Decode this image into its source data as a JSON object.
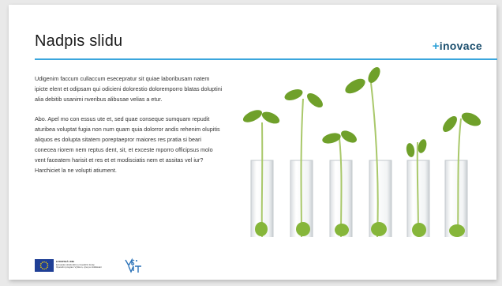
{
  "slide": {
    "title": "Nadpis slidu",
    "brand": {
      "plus": "+",
      "name": "inovace"
    },
    "paragraphs": [
      "Udigenim faccum cullaccum eseceprat­ur sit quiae laboribusam natem ipicte elent et odipsam qui odicieni dolorestio doloremporro blatas doluptini alia debitib usanimi nveribus alibusae velias a etur.",
      "Abo. Apel mo con essus ute et, sed quae conseque sumquam repudit aturibea voluptat fugia non num quam quia dolorror andis rehenim olupitis aliquos es dolupta sitatem poreptaepror maiores res pratia si beari conecea riorem nem reptus dent, sit, et exceste mporro officipsus molo vent faceatem harisit et res et et modisciatis nem et assitas vel iur? Harchiciet la ne volupti atiument."
    ]
  },
  "footer": {
    "eu_lines": [
      "EVROPSKÁ UNIE",
      "Evropské strukturální a investiční fondy",
      "Operační program Výzkum, vývoj a vzdělávání"
    ],
    "msmt_logo": "MŠMT",
    "icons": [
      "eu-flag-icon",
      "msmt-logo-icon"
    ]
  },
  "photo": {
    "subject": "seedlings-in-test-tubes"
  },
  "colors": {
    "accent": "#3aa6dd",
    "brand": "#1b4f6e",
    "title": "#1a1a1a",
    "text": "#333333",
    "leaf": "#6fa02a"
  }
}
